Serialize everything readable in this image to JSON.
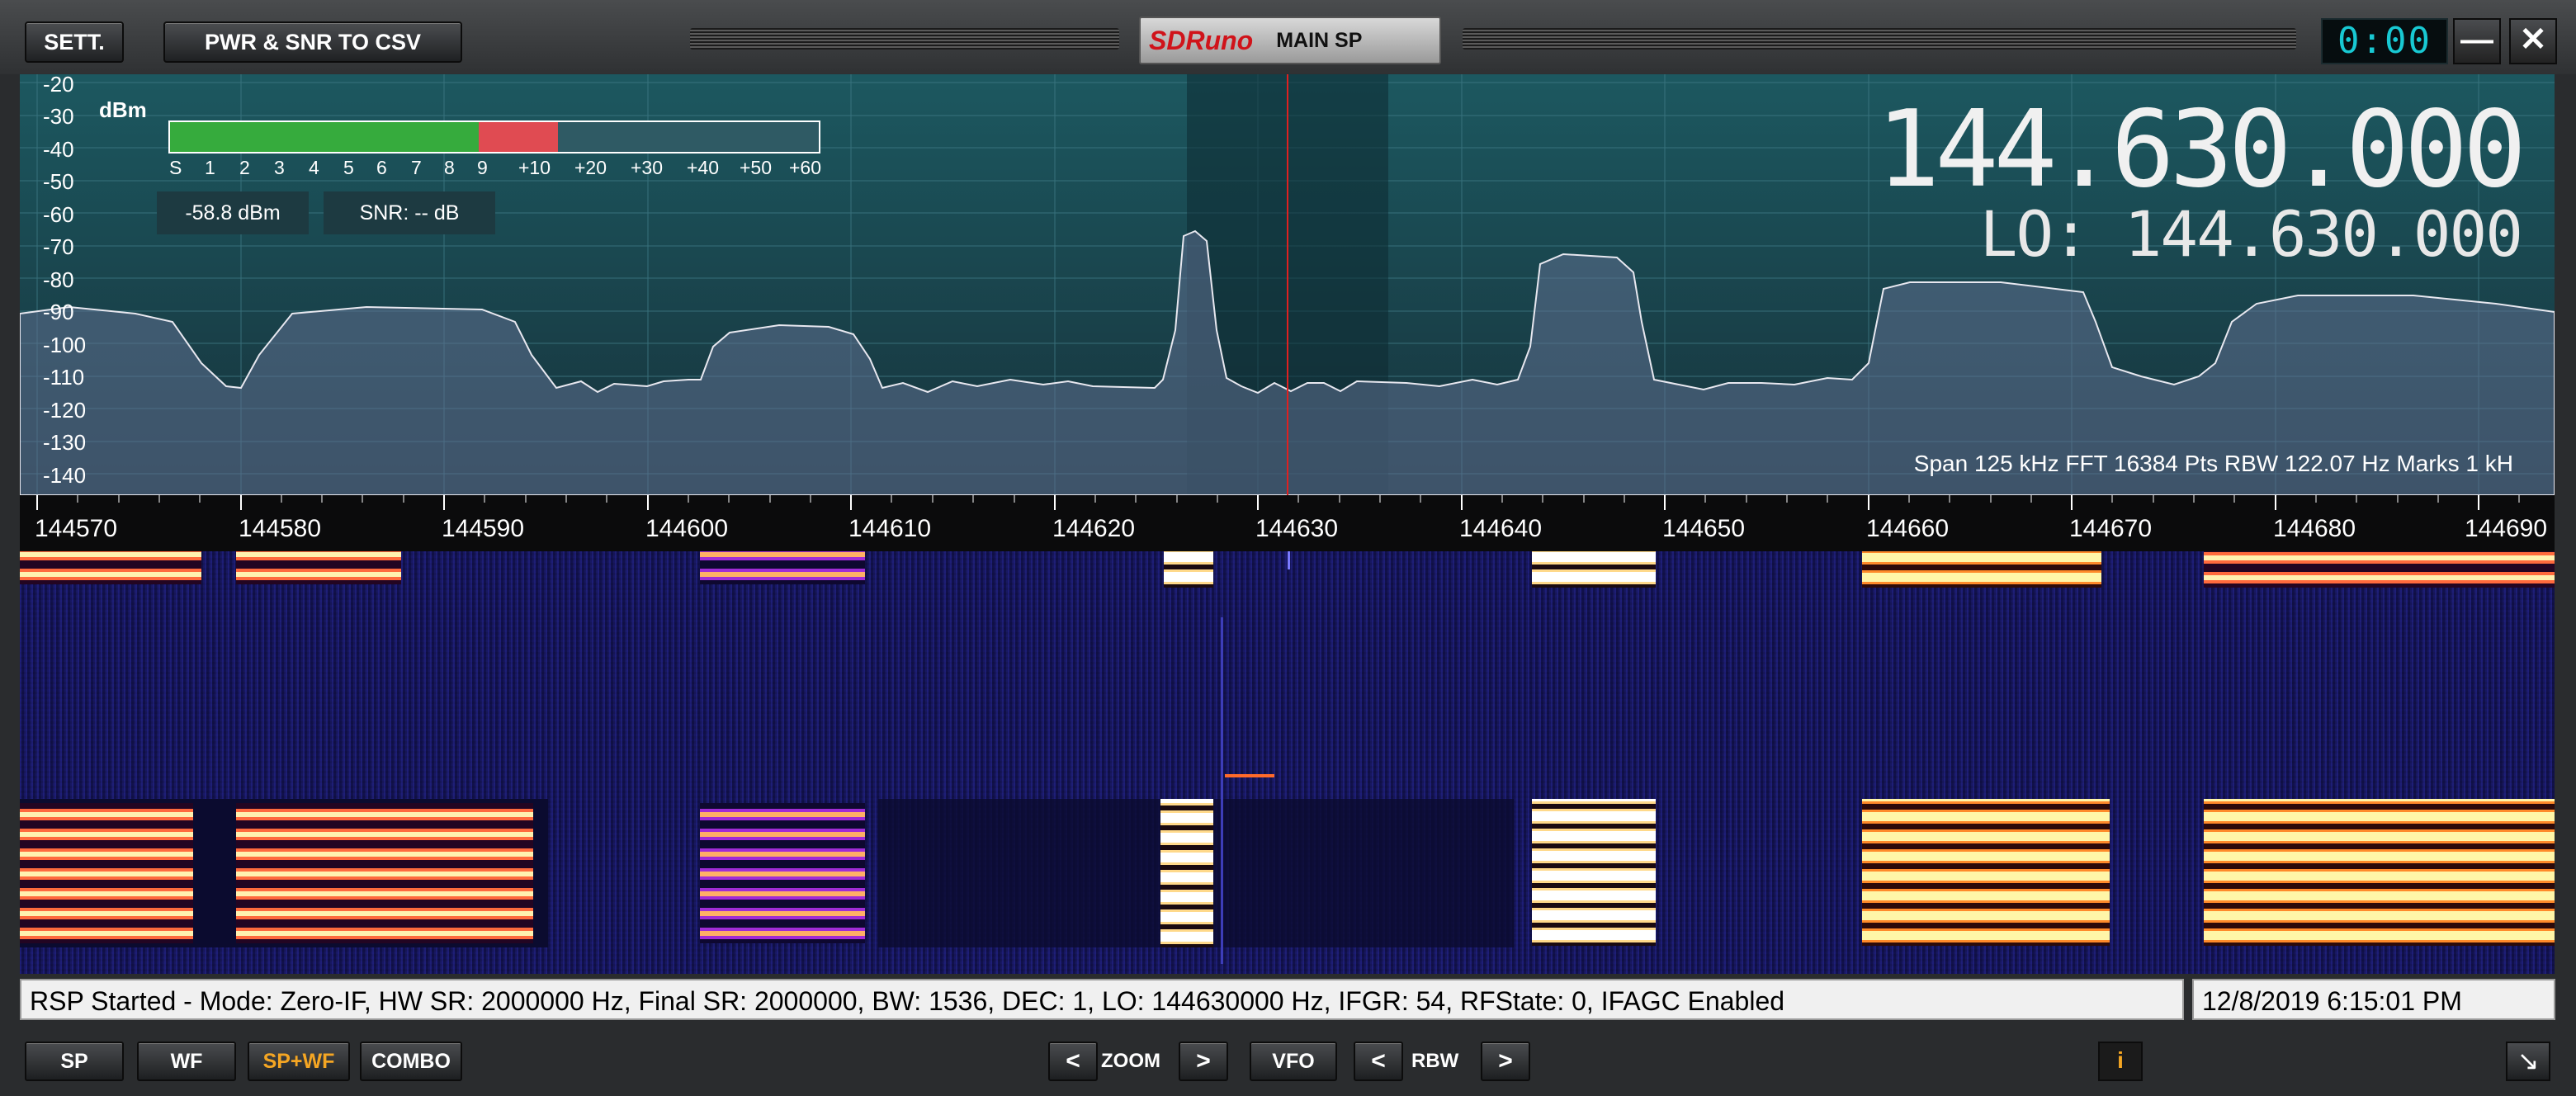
{
  "titlebar": {
    "settings_label": "SETT.",
    "csv_label": "PWR & SNR TO CSV",
    "logo": "SDRuno",
    "panel_name": "MAIN SP",
    "clock": "0:00",
    "minimize": "—",
    "close": "✕"
  },
  "spectrum": {
    "unit": "dBm",
    "y_ticks": [
      "-20",
      "-30",
      "-40",
      "-50",
      "-60",
      "-70",
      "-80",
      "-90",
      "-100",
      "-110",
      "-120",
      "-130",
      "-140"
    ],
    "smeter_scale": [
      "S",
      "1",
      "2",
      "3",
      "4",
      "5",
      "6",
      "7",
      "8",
      "9",
      "+10",
      "+20",
      "+30",
      "+40",
      "+50",
      "+60"
    ],
    "smeter_level": "S9+10",
    "power_readout": "-58.8 dBm",
    "snr_readout": "SNR: -- dB",
    "vfo_frequency": "144.630.000",
    "lo_frequency": "LO: 144.630.000",
    "info_line": "Span 125 kHz   FFT 16384 Pts   RBW 122.07 Hz   Marks 1 kH",
    "accent_colors": {
      "meter_green": "#36ab3d",
      "meter_red": "#e04b52",
      "cursor": "#e02020"
    }
  },
  "freq_axis": [
    "144570",
    "144580",
    "144590",
    "144600",
    "144610",
    "144620",
    "144630",
    "144640",
    "144650",
    "144660",
    "144670",
    "144680",
    "144690"
  ],
  "status": {
    "message": "RSP Started - Mode: Zero-IF, HW SR: 2000000 Hz, Final SR: 2000000, BW: 1536, DEC: 1, LO: 144630000 Hz, IFGR: 54, RFState: 0, IFAGC Enabled",
    "datetime": "12/8/2019 6:15:01 PM"
  },
  "controls": {
    "sp": "SP",
    "wf": "WF",
    "spwf": "SP+WF",
    "combo": "COMBO",
    "zoom_prev": "<",
    "zoom_label": "ZOOM",
    "zoom_next": ">",
    "vfo": "VFO",
    "rbw_prev": "<",
    "rbw_label": "RBW",
    "rbw_next": ">",
    "info": "i",
    "resize": "↘"
  }
}
